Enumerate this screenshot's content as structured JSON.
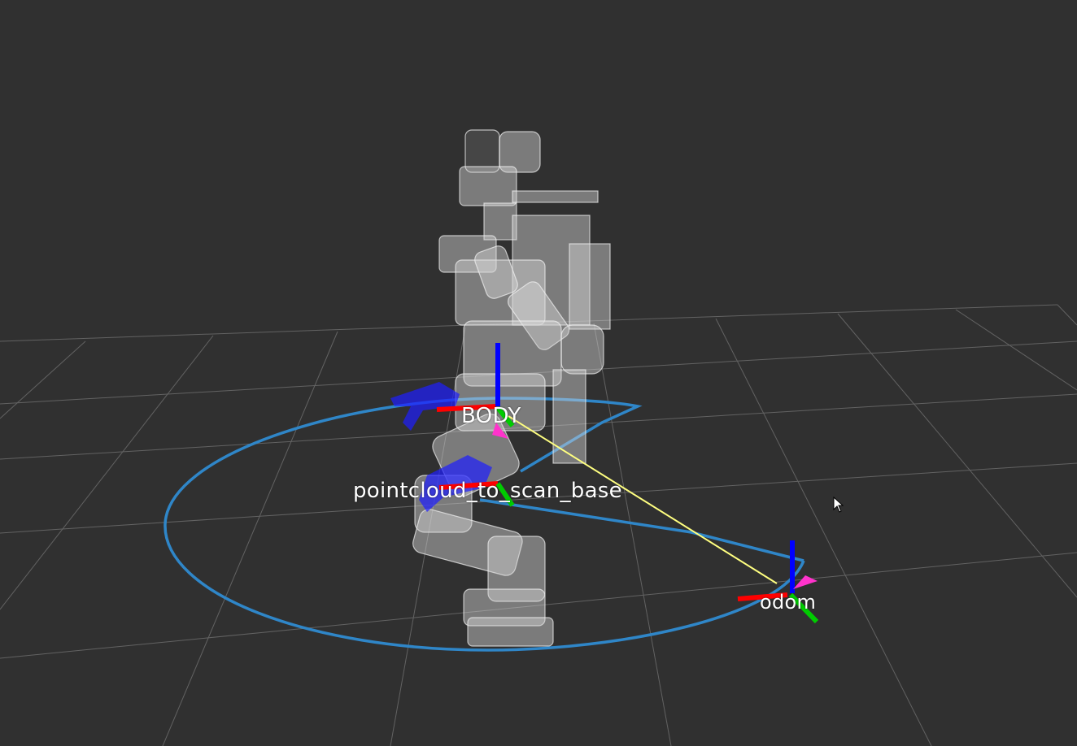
{
  "viewer": {
    "background_color": "#303030",
    "grid_color": "#a0a0a0",
    "path_color": "#2f86c8",
    "tf_link_color": "#ffff80",
    "axis_colors": {
      "x": "#ff0000",
      "y": "#00cc00",
      "z": "#0000ff"
    }
  },
  "frames": {
    "body": "BODY",
    "pointcloud_base": "pointcloud_to_scan_base",
    "odom": "odom"
  },
  "icons": {
    "cursor": "mouse-pointer-icon"
  }
}
